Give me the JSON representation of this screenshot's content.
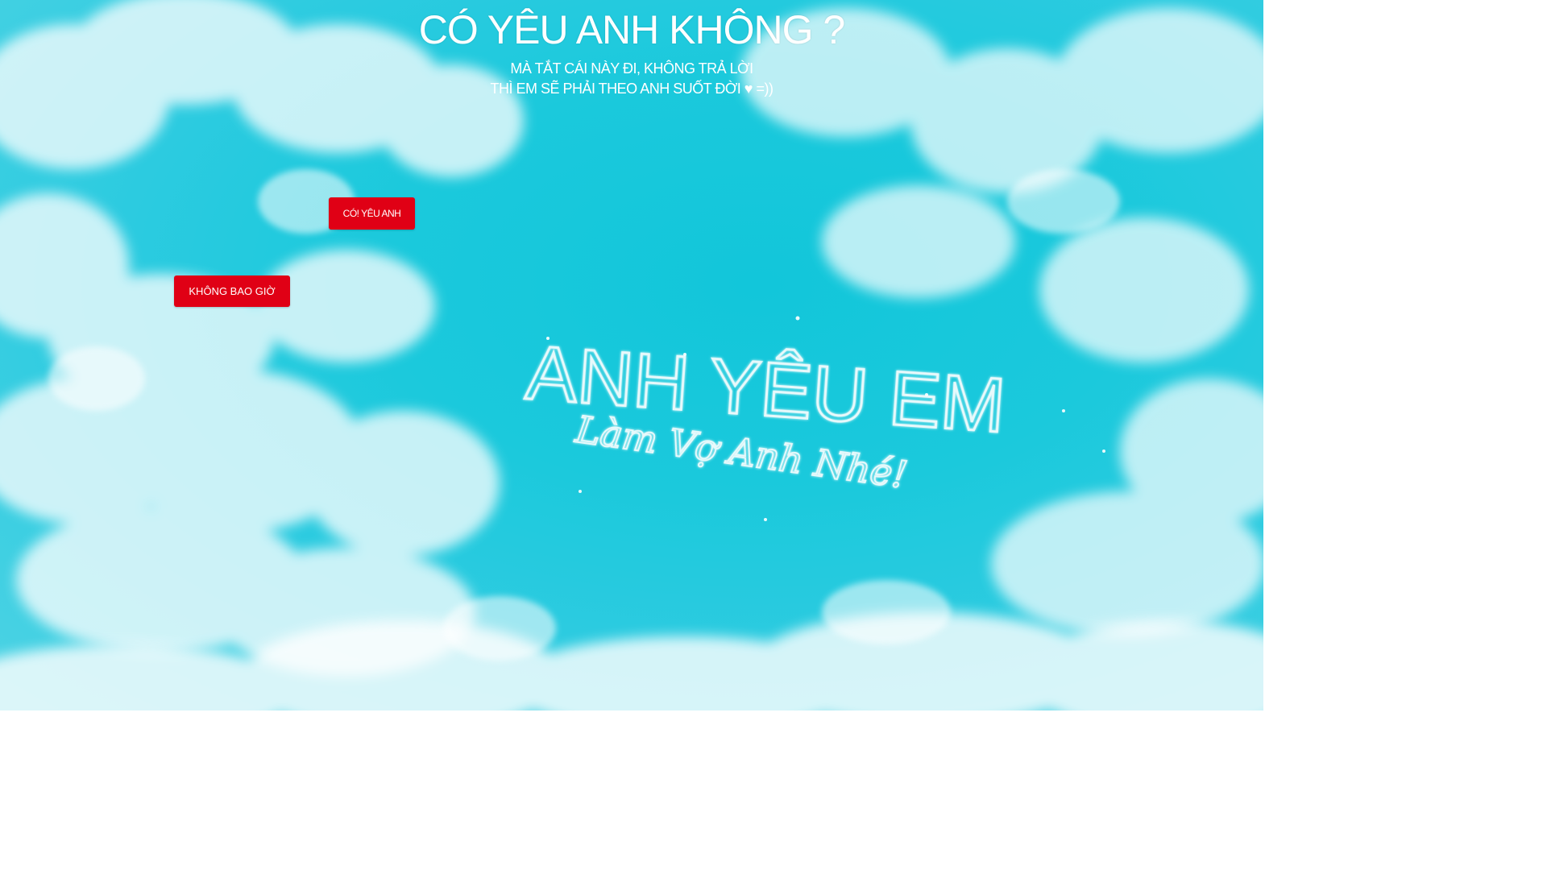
{
  "page": {
    "title": "CÓ YÊU ANH KHÔNG ?",
    "subtitle_line1": "MÀ TẮT CÁI NÀY ĐI, KHÔNG TRẢ LỜI",
    "subtitle_line2": "THÌ EM SẼ PHẢI THEO ANH SUỐT ĐỜI ♥ =))"
  },
  "buttons": {
    "yes_label": "CÓ! YÊU ANH",
    "no_label": "KHÔNG BAO GIỜ"
  },
  "sky_writing": {
    "line1": "ANH YÊU EM",
    "line2": "Làm Vợ Anh Nhé!"
  },
  "colors": {
    "sky": "#1bc9dc",
    "button": "#e00015",
    "text": "#ffffff"
  }
}
